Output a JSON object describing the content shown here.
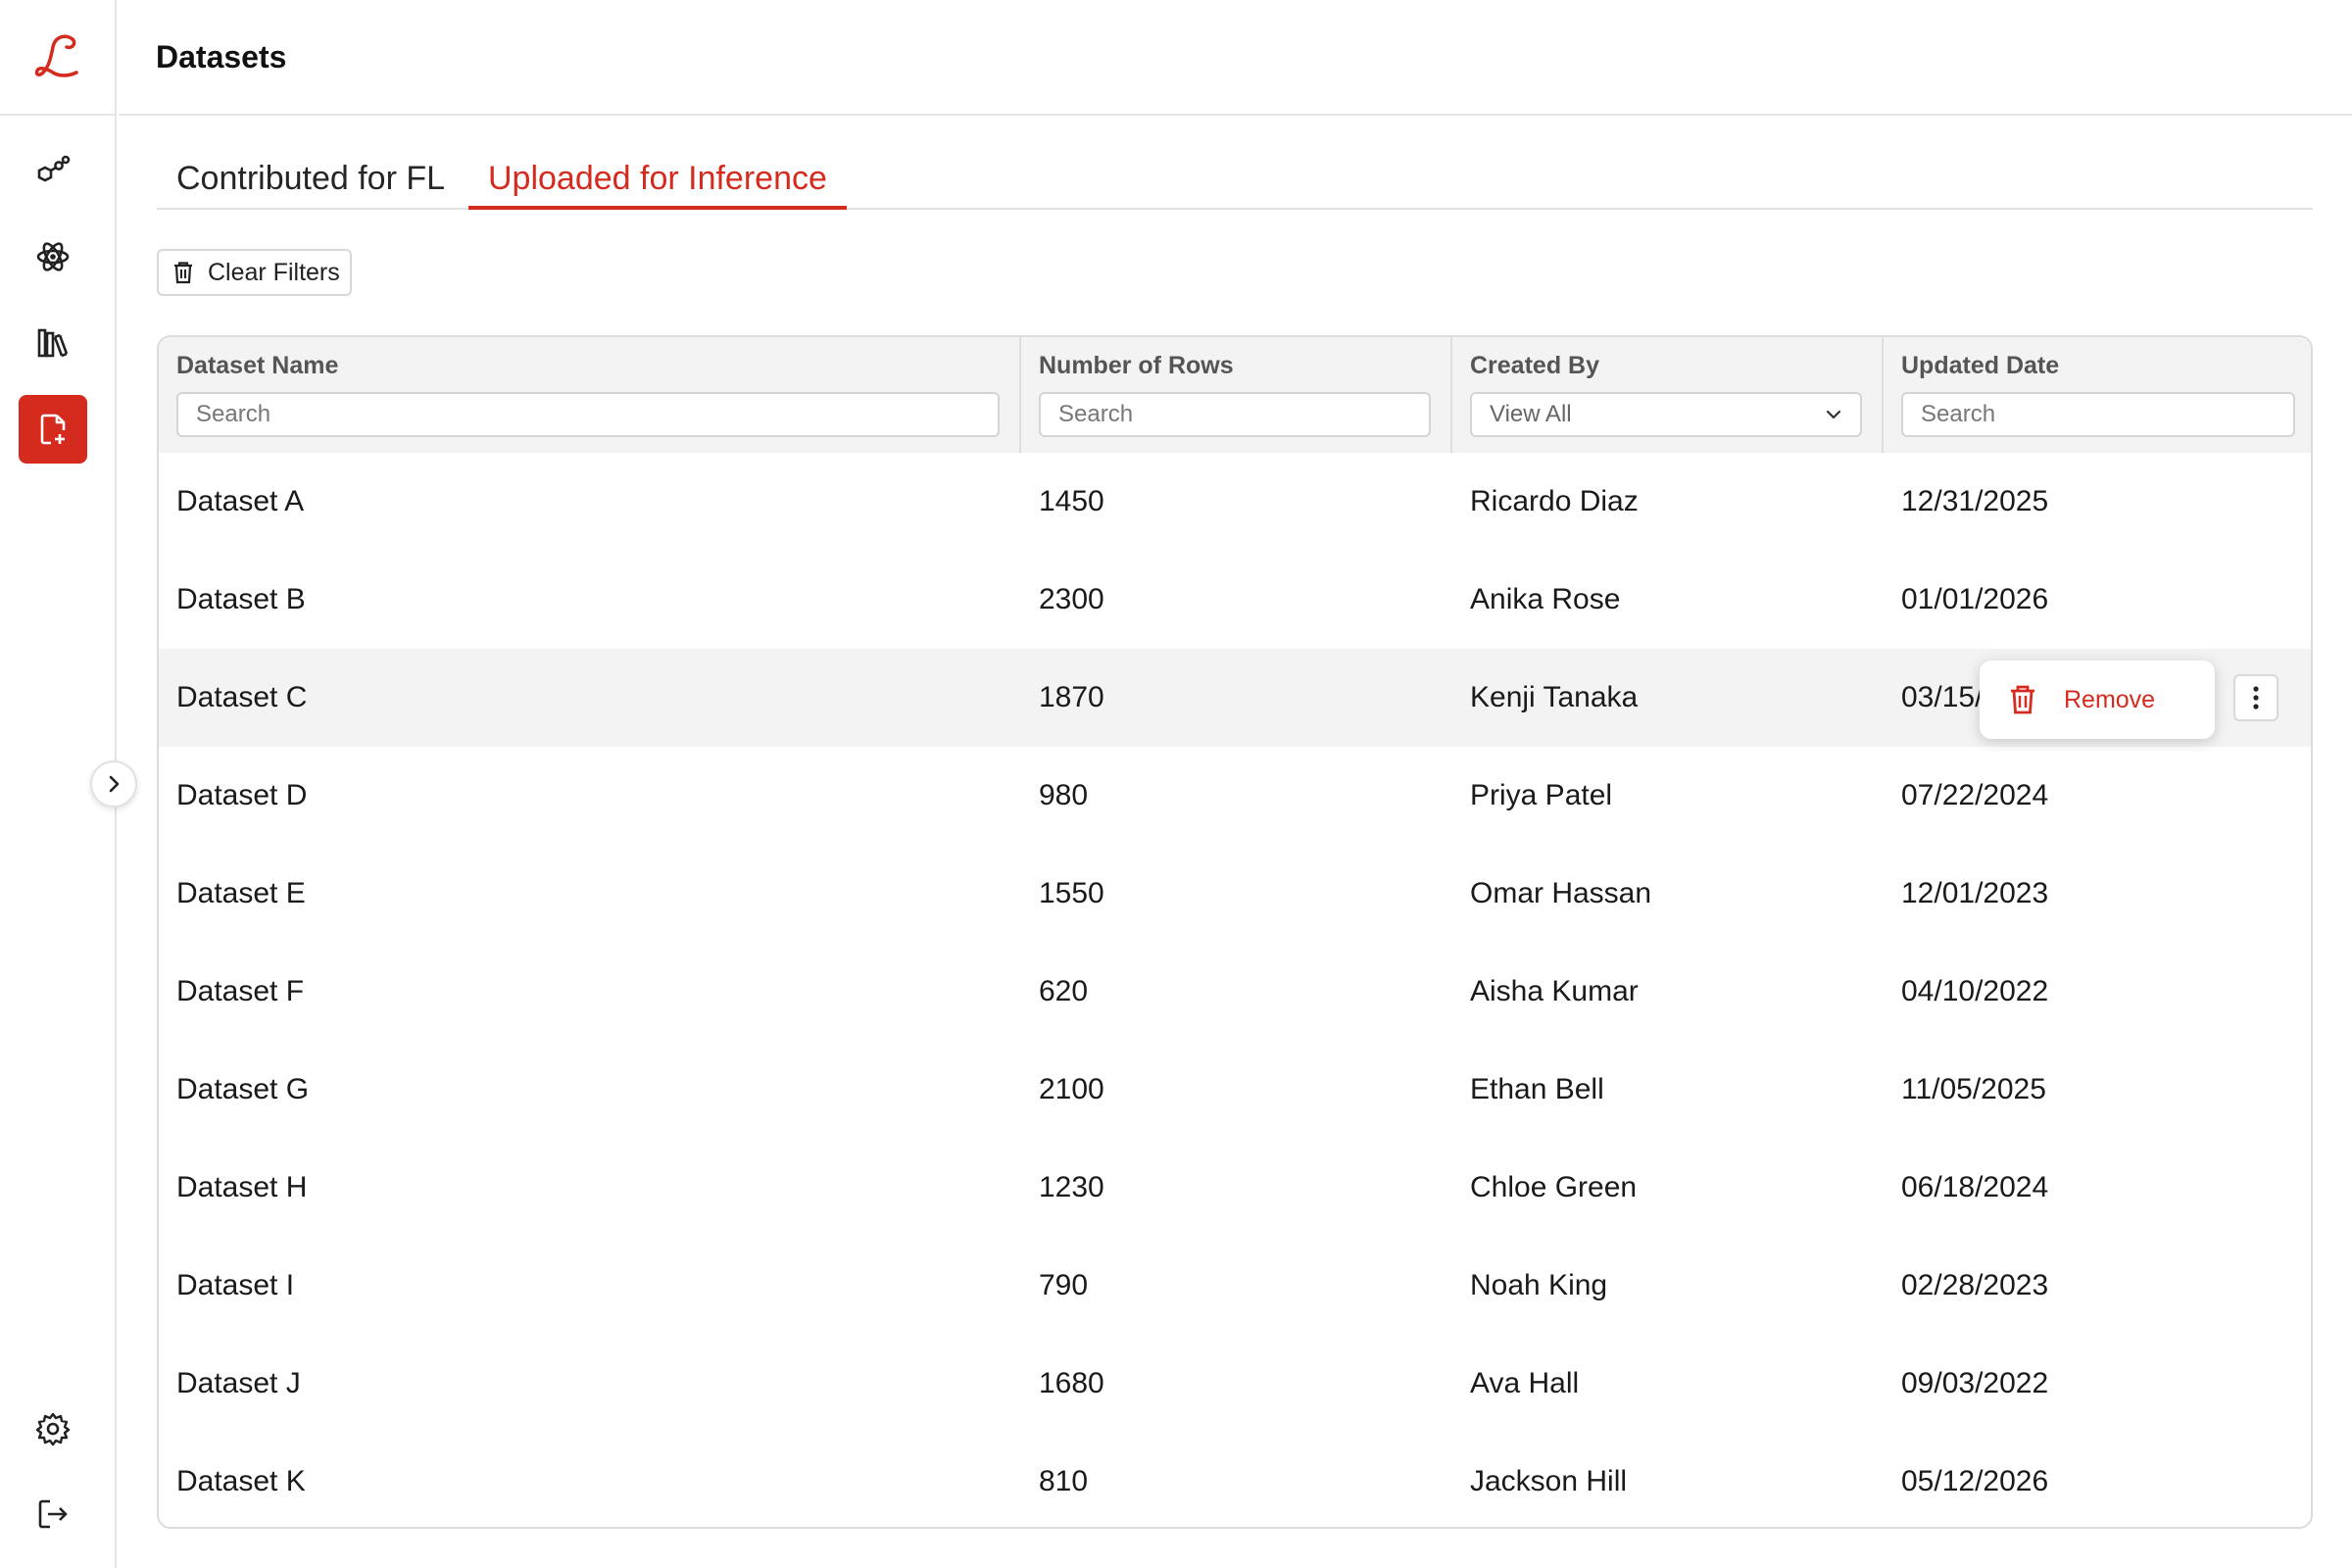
{
  "app": {
    "brand_letter": "L",
    "accent_color": "#d52b1e"
  },
  "header": {
    "title": "Datasets"
  },
  "sidebar": {
    "items": [
      {
        "name": "hexagon-nodes-icon"
      },
      {
        "name": "atom-icon"
      },
      {
        "name": "library-icon"
      },
      {
        "name": "file-plus-icon",
        "active": true
      }
    ],
    "bottom": [
      {
        "name": "gear-icon"
      },
      {
        "name": "logout-icon"
      }
    ]
  },
  "tabs": [
    {
      "label": "Contributed for FL",
      "active": false
    },
    {
      "label": "Uploaded for Inference",
      "active": true
    }
  ],
  "toolbar": {
    "clear_filters_label": "Clear Filters"
  },
  "table": {
    "columns": [
      {
        "label": "Dataset Name",
        "filter_placeholder": "Search"
      },
      {
        "label": "Number of Rows",
        "filter_placeholder": "Search"
      },
      {
        "label": "Created By",
        "filter_value": "View All"
      },
      {
        "label": "Updated Date",
        "filter_placeholder": "Search"
      }
    ],
    "rows": [
      {
        "name": "Dataset A",
        "rows": "1450",
        "created_by": "Ricardo Diaz",
        "updated": "12/31/2025"
      },
      {
        "name": "Dataset B",
        "rows": "2300",
        "created_by": "Anika Rose",
        "updated": "01/01/2026"
      },
      {
        "name": "Dataset C",
        "rows": "1870",
        "created_by": "Kenji Tanaka",
        "updated": "03/15/"
      },
      {
        "name": "Dataset D",
        "rows": "980",
        "created_by": "Priya Patel",
        "updated": "07/22/2024"
      },
      {
        "name": "Dataset E",
        "rows": "1550",
        "created_by": "Omar Hassan",
        "updated": "12/01/2023"
      },
      {
        "name": "Dataset F",
        "rows": "620",
        "created_by": "Aisha Kumar",
        "updated": "04/10/2022"
      },
      {
        "name": "Dataset G",
        "rows": "2100",
        "created_by": "Ethan Bell",
        "updated": "11/05/2025"
      },
      {
        "name": "Dataset H",
        "rows": "1230",
        "created_by": "Chloe Green",
        "updated": "06/18/2024"
      },
      {
        "name": "Dataset I",
        "rows": "790",
        "created_by": "Noah King",
        "updated": "02/28/2023"
      },
      {
        "name": "Dataset J",
        "rows": "1680",
        "created_by": "Ava Hall",
        "updated": "09/03/2022"
      },
      {
        "name": "Dataset K",
        "rows": "810",
        "created_by": "Jackson Hill",
        "updated": "05/12/2026"
      }
    ]
  },
  "row_menu": {
    "remove_label": "Remove"
  }
}
